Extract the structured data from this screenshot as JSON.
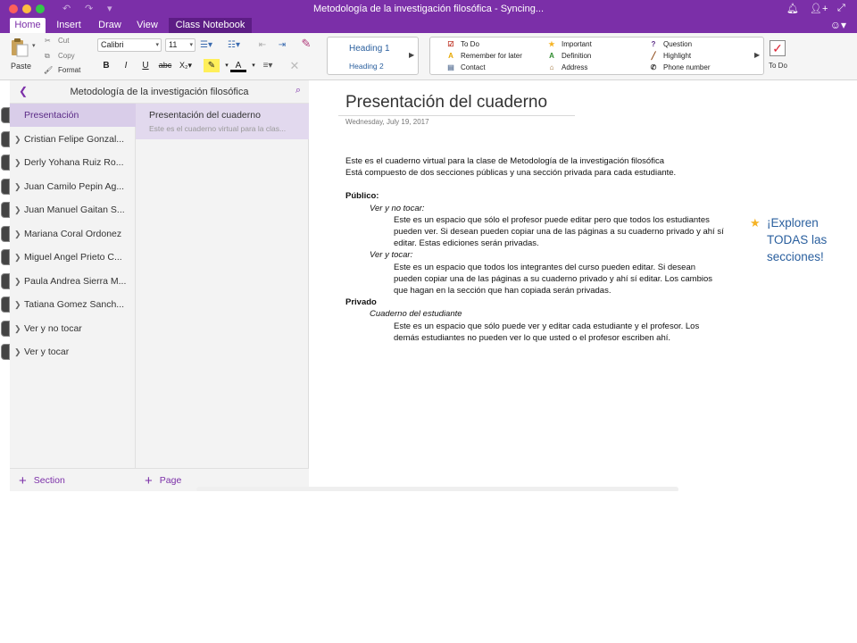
{
  "window": {
    "title": "Metodología de la investigación filosófica - Syncing..."
  },
  "tabs": [
    "Home",
    "Insert",
    "Draw",
    "View",
    "Class Notebook"
  ],
  "ribbon": {
    "paste": "Paste",
    "cut": "Cut",
    "copy": "Copy",
    "format": "Format",
    "font_name": "Calibri",
    "font_size": "11",
    "styles": {
      "heading1": "Heading 1",
      "heading2": "Heading 2"
    },
    "tags": [
      {
        "icon": "checkbox-icon",
        "glyph": "☑",
        "color": "#c0392b",
        "label": "To Do"
      },
      {
        "icon": "star-icon",
        "glyph": "★",
        "color": "#f5b324",
        "label": "Important"
      },
      {
        "icon": "question-icon",
        "glyph": "?",
        "color": "#5a2a86",
        "label": "Question"
      },
      {
        "icon": "remember-icon",
        "glyph": "A",
        "color": "#e6a700",
        "label": "Remember for later"
      },
      {
        "icon": "definition-icon",
        "glyph": "A",
        "color": "#2e8b2e",
        "label": "Definition"
      },
      {
        "icon": "highlight-icon",
        "glyph": "╱",
        "color": "#8b4513",
        "label": "Highlight"
      },
      {
        "icon": "contact-icon",
        "glyph": "▤",
        "color": "#6a7fa0",
        "label": "Contact"
      },
      {
        "icon": "address-icon",
        "glyph": "⌂",
        "color": "#9a6b2f",
        "label": "Address"
      },
      {
        "icon": "phone-icon",
        "glyph": "✆",
        "color": "#333333",
        "label": "Phone number"
      }
    ],
    "todo_label": "To Do"
  },
  "notebook": {
    "title": "Metodología de la investigación filosófica",
    "sections": [
      {
        "label": "Presentación",
        "active": true
      },
      {
        "label": "Cristian Felipe Gonzal...",
        "active": false
      },
      {
        "label": "Derly Yohana Ruiz Ro...",
        "active": false
      },
      {
        "label": "Juan Camilo Pepin Ag...",
        "active": false
      },
      {
        "label": "Juan Manuel Gaitan S...",
        "active": false
      },
      {
        "label": "Mariana Coral Ordonez",
        "active": false
      },
      {
        "label": "Miguel Angel Prieto C...",
        "active": false
      },
      {
        "label": "Paula Andrea Sierra M...",
        "active": false
      },
      {
        "label": "Tatiana Gomez Sanch...",
        "active": false
      },
      {
        "label": "Ver y no tocar",
        "active": false
      },
      {
        "label": "Ver y tocar",
        "active": false
      }
    ],
    "pages": [
      {
        "title": "Presentación del cuaderno",
        "preview": "Este es el cuaderno virtual para la clas..."
      }
    ],
    "add_section": "Section",
    "add_page": "Page"
  },
  "page": {
    "title": "Presentación del cuaderno",
    "date": "Wednesday, July 19, 2017",
    "lines": [
      {
        "text": "Este es el cuaderno virtual para la clase de Metodología de la investigación filosófica",
        "style": "normal"
      },
      {
        "text": "Está compuesto de dos secciones públicas y una sección privada para cada estudiante.",
        "style": "normal"
      },
      {
        "text": "Público:",
        "style": "bold"
      },
      {
        "text": "Ver y no tocar:",
        "style": "italic"
      },
      {
        "text": "Este es un espacio que sólo el profesor puede editar pero que todos los estudiantes",
        "style": "normal"
      },
      {
        "text": "pueden ver. Si desean pueden copiar una de las páginas a su cuaderno privado y ahí sí",
        "style": "normal"
      },
      {
        "text": "editar. Estas ediciones serán privadas.",
        "style": "normal"
      },
      {
        "text": "Ver y tocar:",
        "style": "italic"
      },
      {
        "text": "Este es un espacio que todos los integrantes del curso pueden editar. Si desean",
        "style": "normal"
      },
      {
        "text": "pueden copiar una de las páginas a su cuaderno privado y ahí sí editar. Los cambios",
        "style": "normal"
      },
      {
        "text": "que hagan en la sección que han copiada serán privadas.",
        "style": "normal"
      },
      {
        "text": "Privado",
        "style": "bold"
      },
      {
        "text": "Cuaderno del estudiante",
        "style": "italic"
      },
      {
        "text": "Este es un espacio que sólo puede ver y editar cada estudiante y el profesor. Los",
        "style": "normal"
      },
      {
        "text": "demás estudiantes no pueden ver lo que usted o el profesor escriben ahí.",
        "style": "normal"
      }
    ],
    "note": "¡Exploren TODAS las secciones!"
  },
  "colors": {
    "accent": "#7b2fa8",
    "note_text": "#2a5f9e",
    "star": "#f5b324"
  }
}
